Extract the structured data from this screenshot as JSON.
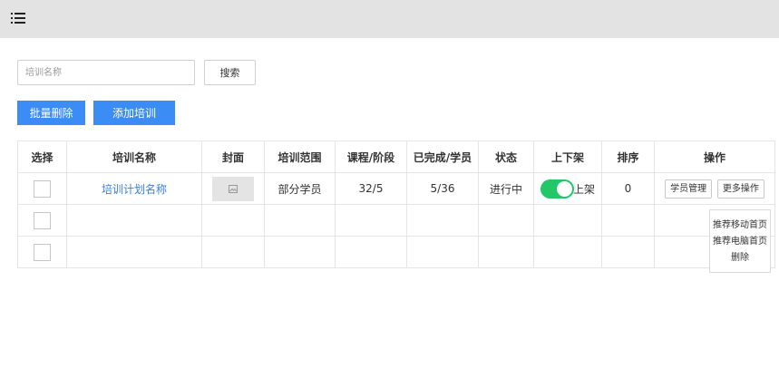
{
  "topbar": {
    "menu_icon": "list-menu-icon"
  },
  "search": {
    "placeholder": "培训名称",
    "value": "",
    "button_label": "搜索"
  },
  "actions": {
    "batch_delete_label": "批量删除",
    "add_training_label": "添加培训"
  },
  "table": {
    "headers": [
      "选择",
      "培训名称",
      "封面",
      "培训范围",
      "课程/阶段",
      "已完成/学员",
      "状态",
      "上下架",
      "排序",
      "操作"
    ],
    "rows": [
      {
        "name": "培训计划名称",
        "cover_icon": "image-placeholder-icon",
        "scope": "部分学员",
        "courses": "32/5",
        "completed": "5/36",
        "status": "进行中",
        "shelf_on": true,
        "shelf_label": "上架",
        "order": "0",
        "op_student_manage": "学员管理",
        "op_more": "更多操作"
      }
    ]
  },
  "dropdown": {
    "items": [
      "推荐移动首页",
      "推荐电脑首页",
      "删除"
    ]
  },
  "colors": {
    "primary": "#3b8cf5",
    "toggle_on": "#22c768",
    "link": "#3b7fd9",
    "topbar": "#e3e3e3"
  }
}
